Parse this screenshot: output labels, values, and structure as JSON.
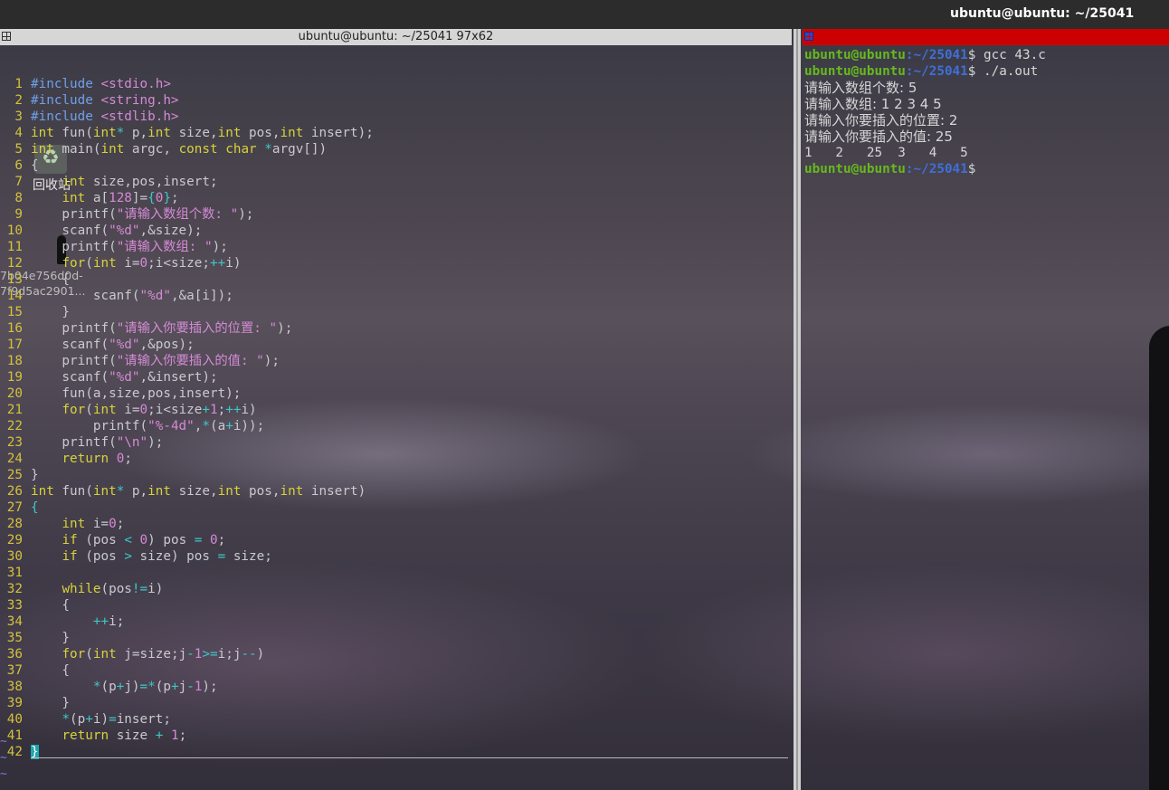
{
  "topbar": {
    "title": "ubuntu@ubuntu: ~/25041"
  },
  "left_terminal": {
    "title": "ubuntu@ubuntu: ~/25041 97x62",
    "lines": [
      [
        [
          "pp",
          "#include "
        ],
        [
          "st",
          "<stdio.h>"
        ]
      ],
      [
        [
          "pp",
          "#include "
        ],
        [
          "st",
          "<string.h>"
        ]
      ],
      [
        [
          "pp",
          "#include "
        ],
        [
          "st",
          "<stdlib.h>"
        ]
      ],
      [
        [
          "kw",
          "int"
        ],
        [
          "tx",
          " fun("
        ],
        [
          "kw",
          "int"
        ],
        [
          "op",
          "*"
        ],
        [
          "tx",
          " p,"
        ],
        [
          "kw",
          "int"
        ],
        [
          "tx",
          " size,"
        ],
        [
          "kw",
          "int"
        ],
        [
          "tx",
          " pos,"
        ],
        [
          "kw",
          "int"
        ],
        [
          "tx",
          " insert);"
        ]
      ],
      [
        [
          "kw",
          "int"
        ],
        [
          "tx",
          " main("
        ],
        [
          "kw",
          "int"
        ],
        [
          "tx",
          " argc, "
        ],
        [
          "kw",
          "const char"
        ],
        [
          "tx",
          " "
        ],
        [
          "op",
          "*"
        ],
        [
          "tx",
          "argv[])"
        ]
      ],
      [
        [
          "tx",
          "{"
        ]
      ],
      [
        [
          "tx",
          "    "
        ],
        [
          "kw",
          "int"
        ],
        [
          "tx",
          " size,pos,insert;"
        ]
      ],
      [
        [
          "tx",
          "    "
        ],
        [
          "kw",
          "int"
        ],
        [
          "tx",
          " a["
        ],
        [
          "nm",
          "128"
        ],
        [
          "tx",
          "]="
        ],
        [
          "op",
          "{"
        ],
        [
          "nm",
          "0"
        ],
        [
          "op",
          "}"
        ],
        [
          "tx",
          ";"
        ]
      ],
      [
        [
          "tx",
          "    printf("
        ],
        [
          "st",
          "\"请输入数组个数: \""
        ],
        [
          "tx",
          ");"
        ]
      ],
      [
        [
          "tx",
          "    scanf("
        ],
        [
          "st",
          "\"%d\""
        ],
        [
          "tx",
          ",&size);"
        ]
      ],
      [
        [
          "tx",
          "    printf("
        ],
        [
          "st",
          "\"请输入数组: \""
        ],
        [
          "tx",
          ");"
        ]
      ],
      [
        [
          "tx",
          "    "
        ],
        [
          "kw",
          "for"
        ],
        [
          "tx",
          "("
        ],
        [
          "kw",
          "int"
        ],
        [
          "tx",
          " i="
        ],
        [
          "nm",
          "0"
        ],
        [
          "tx",
          ";i<size;"
        ],
        [
          "op",
          "++"
        ],
        [
          "tx",
          "i)"
        ]
      ],
      [
        [
          "tx",
          "    {"
        ]
      ],
      [
        [
          "tx",
          "        scanf("
        ],
        [
          "st",
          "\"%d\""
        ],
        [
          "tx",
          ",&a[i]);"
        ]
      ],
      [
        [
          "tx",
          "    }"
        ]
      ],
      [
        [
          "tx",
          "    printf("
        ],
        [
          "st",
          "\"请输入你要插入的位置: \""
        ],
        [
          "tx",
          ");"
        ]
      ],
      [
        [
          "tx",
          "    scanf("
        ],
        [
          "st",
          "\"%d\""
        ],
        [
          "tx",
          ",&pos);"
        ]
      ],
      [
        [
          "tx",
          "    printf("
        ],
        [
          "st",
          "\"请输入你要插入的值: \""
        ],
        [
          "tx",
          ");"
        ]
      ],
      [
        [
          "tx",
          "    scanf("
        ],
        [
          "st",
          "\"%d\""
        ],
        [
          "tx",
          ",&insert);"
        ]
      ],
      [
        [
          "tx",
          "    fun(a,size,pos,insert);"
        ]
      ],
      [
        [
          "tx",
          "    "
        ],
        [
          "kw",
          "for"
        ],
        [
          "tx",
          "("
        ],
        [
          "kw",
          "int"
        ],
        [
          "tx",
          " i="
        ],
        [
          "nm",
          "0"
        ],
        [
          "tx",
          ";i<size"
        ],
        [
          "op",
          "+"
        ],
        [
          "nm",
          "1"
        ],
        [
          "tx",
          ";"
        ],
        [
          "op",
          "++"
        ],
        [
          "tx",
          "i)"
        ]
      ],
      [
        [
          "tx",
          "        printf("
        ],
        [
          "st",
          "\"%-4d\""
        ],
        [
          "tx",
          ","
        ],
        [
          "op",
          "*"
        ],
        [
          "tx",
          "(a"
        ],
        [
          "op",
          "+"
        ],
        [
          "tx",
          "i));"
        ]
      ],
      [
        [
          "tx",
          "    printf("
        ],
        [
          "st",
          "\"\\n\""
        ],
        [
          "tx",
          ");"
        ]
      ],
      [
        [
          "tx",
          "    "
        ],
        [
          "kw",
          "return"
        ],
        [
          "tx",
          " "
        ],
        [
          "nm",
          "0"
        ],
        [
          "tx",
          ";"
        ]
      ],
      [
        [
          "tx",
          "}"
        ]
      ],
      [
        [
          "kw",
          "int"
        ],
        [
          "tx",
          " fun("
        ],
        [
          "kw",
          "int"
        ],
        [
          "op",
          "*"
        ],
        [
          "tx",
          " p,"
        ],
        [
          "kw",
          "int"
        ],
        [
          "tx",
          " size,"
        ],
        [
          "kw",
          "int"
        ],
        [
          "tx",
          " pos,"
        ],
        [
          "kw",
          "int"
        ],
        [
          "tx",
          " insert)"
        ]
      ],
      [
        [
          "op",
          "{"
        ]
      ],
      [
        [
          "tx",
          "    "
        ],
        [
          "kw",
          "int"
        ],
        [
          "tx",
          " i="
        ],
        [
          "nm",
          "0"
        ],
        [
          "tx",
          ";"
        ]
      ],
      [
        [
          "tx",
          "    "
        ],
        [
          "kw",
          "if"
        ],
        [
          "tx",
          " (pos "
        ],
        [
          "op",
          "<"
        ],
        [
          "tx",
          " "
        ],
        [
          "nm",
          "0"
        ],
        [
          "tx",
          ") pos "
        ],
        [
          "op",
          "="
        ],
        [
          "tx",
          " "
        ],
        [
          "nm",
          "0"
        ],
        [
          "tx",
          ";"
        ]
      ],
      [
        [
          "tx",
          "    "
        ],
        [
          "kw",
          "if"
        ],
        [
          "tx",
          " (pos "
        ],
        [
          "op",
          ">"
        ],
        [
          "tx",
          " size) pos "
        ],
        [
          "op",
          "="
        ],
        [
          "tx",
          " size;"
        ]
      ],
      [
        [
          "tx",
          ""
        ]
      ],
      [
        [
          "tx",
          "    "
        ],
        [
          "kw",
          "while"
        ],
        [
          "tx",
          "(pos"
        ],
        [
          "op",
          "!="
        ],
        [
          "tx",
          "i)"
        ]
      ],
      [
        [
          "tx",
          "    {"
        ]
      ],
      [
        [
          "tx",
          "        "
        ],
        [
          "op",
          "++"
        ],
        [
          "tx",
          "i;"
        ]
      ],
      [
        [
          "tx",
          "    }"
        ]
      ],
      [
        [
          "tx",
          "    "
        ],
        [
          "kw",
          "for"
        ],
        [
          "tx",
          "("
        ],
        [
          "kw",
          "int"
        ],
        [
          "tx",
          " j=size;j"
        ],
        [
          "op",
          "-"
        ],
        [
          "nm",
          "1"
        ],
        [
          "op",
          ">="
        ],
        [
          "tx",
          "i;j"
        ],
        [
          "op",
          "--"
        ],
        [
          "tx",
          ")"
        ]
      ],
      [
        [
          "tx",
          "    {"
        ]
      ],
      [
        [
          "tx",
          "        "
        ],
        [
          "op",
          "*"
        ],
        [
          "tx",
          "(p"
        ],
        [
          "op",
          "+"
        ],
        [
          "tx",
          "j)"
        ],
        [
          "op",
          "="
        ],
        [
          "op",
          "*"
        ],
        [
          "tx",
          "(p"
        ],
        [
          "op",
          "+"
        ],
        [
          "tx",
          "j"
        ],
        [
          "op",
          "-"
        ],
        [
          "nm",
          "1"
        ],
        [
          "tx",
          ");"
        ]
      ],
      [
        [
          "tx",
          "    }"
        ]
      ],
      [
        [
          "tx",
          "    "
        ],
        [
          "op",
          "*"
        ],
        [
          "tx",
          "(p"
        ],
        [
          "op",
          "+"
        ],
        [
          "tx",
          "i)"
        ],
        [
          "op",
          "="
        ],
        [
          "tx",
          "insert;"
        ]
      ],
      [
        [
          "tx",
          "    "
        ],
        [
          "kw",
          "return"
        ],
        [
          "tx",
          " size "
        ],
        [
          "op",
          "+"
        ],
        [
          "tx",
          " "
        ],
        [
          "nm",
          "1"
        ],
        [
          "tx",
          ";"
        ]
      ],
      [
        [
          "cur",
          "}"
        ]
      ]
    ],
    "tilde": "~"
  },
  "desktop": {
    "trash_label": "回收站",
    "file_label_1": "7b04e756d0d-",
    "file_label_2": "7f9d5ac2901..."
  },
  "right_terminal": {
    "prompt_user": "ubuntu@ubuntu",
    "prompt_path": ":~/25041",
    "lines": [
      {
        "type": "prompt",
        "cmd": "$ gcc 43.c"
      },
      {
        "type": "prompt",
        "cmd": "$ ./a.out"
      },
      {
        "type": "text",
        "text": "请输入数组个数: 5"
      },
      {
        "type": "text",
        "text": "请输入数组: 1 2 3 4 5"
      },
      {
        "type": "text",
        "text": "请输入你要插入的位置: 2"
      },
      {
        "type": "text",
        "text": "请输入你要插入的值: 25"
      },
      {
        "type": "text",
        "text": "1   2   25  3   4   5"
      },
      {
        "type": "prompt",
        "cmd": "$ "
      }
    ]
  },
  "colors": {
    "title_red": "#cc0000",
    "line_number": "#d2c23c",
    "keyword": "#d7d23a",
    "string": "#d48ad6",
    "prompt_user": "#66b91e",
    "prompt_path": "#3f6fd8"
  }
}
